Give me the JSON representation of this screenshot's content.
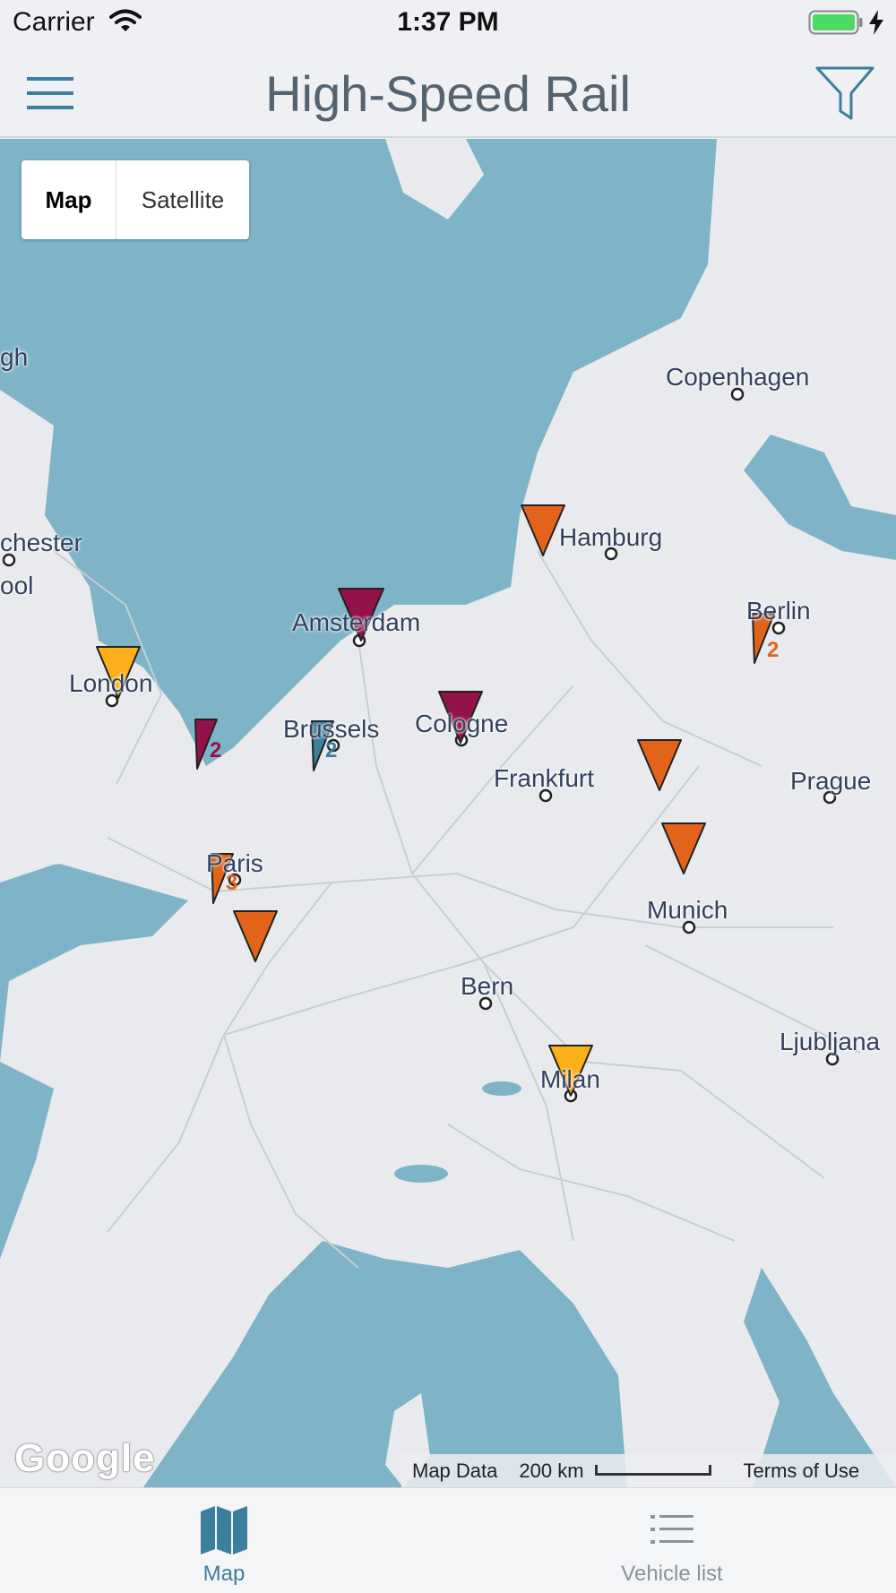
{
  "status_bar": {
    "carrier": "Carrier",
    "time": "1:37 PM",
    "icons": [
      "wifi-icon",
      "battery-icon",
      "charging-bolt-icon"
    ]
  },
  "nav_bar": {
    "title": "High-Speed Rail",
    "left_icon": "hamburger-menu-icon",
    "right_icon": "filter-funnel-icon"
  },
  "map": {
    "map_type": {
      "options": [
        "Map",
        "Satellite"
      ],
      "selected": "Map"
    },
    "cities": {
      "copenhagen": "Copenhagen",
      "hamburg": "Hamburg",
      "berlin": "Berlin",
      "amsterdam": "Amsterdam",
      "london": "London",
      "brussels": "Brussels",
      "cologne": "Cologne",
      "frankfurt": "Frankfurt",
      "prague": "Prague",
      "paris": "Paris",
      "munich": "Munich",
      "bern": "Bern",
      "ljubljana": "Ljubljana",
      "milan": "Milan",
      "manchester_partial": "chester",
      "liverpool_partial": "ool",
      "edinburgh_partial": "gh"
    },
    "cluster_counts": {
      "berlin": "2",
      "channel": "2",
      "brussels": "2",
      "paris": "3"
    },
    "marker_colors": {
      "orange": "#e2641a",
      "magenta": "#93124a",
      "yellow": "#fbb01a",
      "blue": "#3b7f9c"
    },
    "attribution": {
      "map_data": "Map Data",
      "scale": "200 km",
      "terms": "Terms of Use",
      "provider": "Google"
    }
  },
  "tab_bar": {
    "tabs": [
      {
        "label": "Vehicle list",
        "icon": "list-icon",
        "selected": false
      },
      {
        "label": "Map",
        "icon": "map-icon",
        "selected": true
      }
    ],
    "active_color": "#3b7f9c",
    "inactive_color": "#8a929a"
  }
}
